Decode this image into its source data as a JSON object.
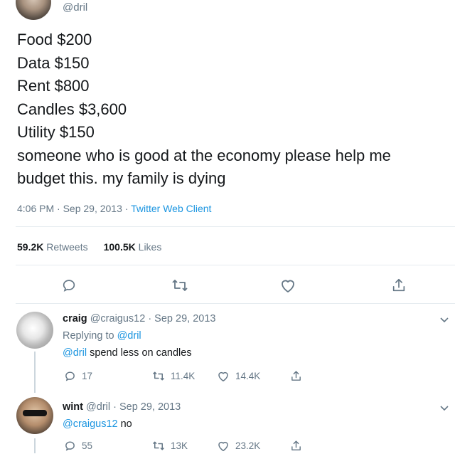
{
  "tweet": {
    "handle": "@dril",
    "lines": [
      "Food $200",
      "Data $150",
      "Rent $800",
      "Candles $3,600",
      "Utility $150",
      "someone who is good at the economy please help me",
      "budget this. my family is dying"
    ],
    "time": "4:06 PM · Sep 29, 2013 · ",
    "client": "Twitter Web Client",
    "retweets_count": "59.2K",
    "retweets_label": "Retweets",
    "likes_count": "100.5K",
    "likes_label": "Likes"
  },
  "replies": [
    {
      "name": "craig",
      "handle_date": "@craigus12 · Sep 29, 2013",
      "replying_prefix": "Replying to ",
      "replying_handle": "@dril",
      "mention": "@dril",
      "text": " spend less on candles",
      "reply_count": "17",
      "retweet_count": "11.4K",
      "like_count": "14.4K"
    },
    {
      "name": "wint",
      "handle_date": "@dril · Sep 29, 2013",
      "mention": "@craigus12",
      "text": " no",
      "reply_count": "55",
      "retweet_count": "13K",
      "like_count": "23.2K"
    }
  ],
  "colors": {
    "link": "#1b95e0",
    "muted": "#657786",
    "text": "#14171a",
    "divider": "#e6ecf0"
  },
  "icons": [
    "reply-icon",
    "retweet-icon",
    "like-icon",
    "share-icon",
    "chevron-down-icon"
  ]
}
